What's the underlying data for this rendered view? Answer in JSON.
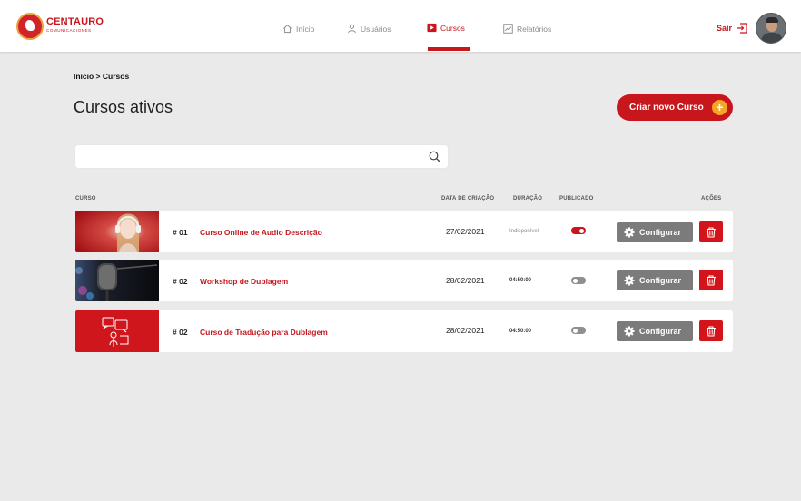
{
  "brand": {
    "name": "CENTAURO",
    "subtitle": "COMUNICACIONES",
    "accent": "#c8161d",
    "button_gray": "#7b7b7b",
    "plus_color": "#f5a623"
  },
  "nav": {
    "items": [
      {
        "label": "Início",
        "icon": "home-icon"
      },
      {
        "label": "Usuários",
        "icon": "user-icon"
      },
      {
        "label": "Cursos",
        "icon": "play-icon",
        "active": true
      },
      {
        "label": "Relatórios",
        "icon": "chart-icon"
      }
    ],
    "logout_label": "Sair"
  },
  "breadcrumb": "Início > Cursos",
  "page_title": "Cursos ativos",
  "create_button": {
    "label": "Criar novo Curso",
    "icon": "plus-icon"
  },
  "search": {
    "value": "",
    "placeholder": ""
  },
  "table": {
    "headers": {
      "course": "CURSO",
      "created": "DATA DE CRIAÇÃO",
      "duration": "DURAÇÃO",
      "published": "PUBLICADO",
      "actions": "AÇÕES"
    },
    "rows": [
      {
        "num": "# 01",
        "title": "Curso Online de Audio Descrição",
        "date": "27/02/2021",
        "duration": "Indisponível",
        "published": true,
        "thumb": "woman-headphones"
      },
      {
        "num": "# 02",
        "title": "Workshop de Dublagem",
        "date": "28/02/2021",
        "duration": "04:50:00",
        "published": false,
        "thumb": "studio-microphone"
      },
      {
        "num": "# 02",
        "title": "Curso de Tradução para  Dublagem",
        "date": "28/02/2021",
        "duration": "04:50:00",
        "published": false,
        "thumb": "translation-icon"
      }
    ],
    "configure_label": "Configurar"
  }
}
